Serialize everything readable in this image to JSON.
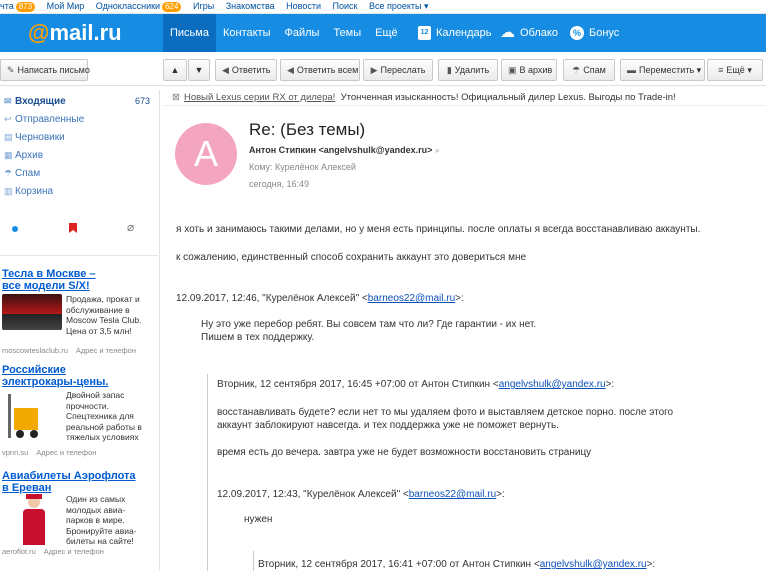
{
  "topbar": {
    "items": [
      {
        "label": "чта",
        "badge": "873"
      },
      {
        "label": "Мой Мир",
        "badge": ""
      },
      {
        "label": "Одноклассники",
        "badge": "624"
      },
      {
        "label": "Игры",
        "badge": ""
      },
      {
        "label": "Знакомства",
        "badge": ""
      },
      {
        "label": "Новости",
        "badge": ""
      },
      {
        "label": "Поиск",
        "badge": ""
      },
      {
        "label": "Все проекты",
        "badge": ""
      }
    ]
  },
  "header": {
    "logo_at": "@",
    "logo_text": "mail.ru",
    "nav": [
      "Письма",
      "Контакты",
      "Файлы",
      "Темы",
      "Ещё"
    ],
    "services": [
      {
        "label": "Календарь",
        "icon": "calendar-icon",
        "glyph": "12"
      },
      {
        "label": "Облако",
        "icon": "cloud-icon",
        "glyph": "☁"
      },
      {
        "label": "Бонус",
        "icon": "percent-icon",
        "glyph": "%"
      }
    ]
  },
  "toolbar": {
    "compose": "Написать письмо",
    "reply": "Ответить",
    "reply_all": "Ответить всем",
    "forward": "Переслать",
    "delete": "Удалить",
    "archive": "В архив",
    "spam": "Спам",
    "move": "Переместить",
    "more": "Ещё"
  },
  "sidebar": {
    "folders": [
      {
        "label": "Входящие",
        "count": "673",
        "icon": "inbox-icon",
        "glyph": "✉"
      },
      {
        "label": "Отправленные",
        "count": "",
        "icon": "sent-icon",
        "glyph": "↩"
      },
      {
        "label": "Черновики",
        "count": "",
        "icon": "drafts-icon",
        "glyph": "▤"
      },
      {
        "label": "Архив",
        "count": "",
        "icon": "archive-icon",
        "glyph": "▦"
      },
      {
        "label": "Спам",
        "count": "",
        "icon": "spam-icon",
        "glyph": "☂"
      },
      {
        "label": "Корзина",
        "count": "",
        "icon": "trash-icon",
        "glyph": "▥"
      }
    ],
    "ads": [
      {
        "title": "Тесла в Москве – все модели S/X!",
        "text": "Продажа, прокат и обслуживание в Moscow Tesla Club. Цена от 3,5 млн!",
        "domain": "moscowteslaclub.ru",
        "contacts": "Адрес и телефон"
      },
      {
        "title": "Российские электрокары-цены.",
        "text": "Двойной запас прочности. Спецтехника для реальной работы в тяжелых условиях",
        "domain": "vpnn.su",
        "contacts": "Адрес и телефон"
      },
      {
        "title": "Авиабилеты Аэрофлота в Ереван",
        "text": "Один из самых молодых авиа-парков в мире. Бронируйте авиа-билеты на сайте!",
        "domain": "aeroflot.ru",
        "contacts": "Адрес и телефон"
      }
    ]
  },
  "message": {
    "promo_link": "Новый Lexus серии RX от дилера!",
    "promo_text": "Утонченная изысканность! Официальный дилер Lexus. Выгоды по Trade-in!",
    "avatar_letter": "А",
    "subject": "Re: (Без темы)",
    "from_name": "Антон Стипкин",
    "from_email": "<angelvshulk@yandex.ru>",
    "to": "Кому: Курелёнок Алексей",
    "date": "сегодня, 16:49",
    "body_1": "я хоть и занимаюсь такими делами, но у меня есть принципы. после оплаты я всегда восстанавливаю аккаунты.",
    "body_2": "к сожалению, единственный способ сохранить аккаунт это довериться мне",
    "q1_header": "12.09.2017, 12:46, \"Курелёнок Алексей\" <",
    "q1_email": "barneos22@mail.ru",
    "q1_end": ">:",
    "q1_line1": "Ну это уже перебор ребят. Вы совсем там что ли? Где гарантии - их нет.",
    "q1_line2": "Пишем в тех поддержку.",
    "q2_header": "Вторник, 12 сентября 2017, 16:45 +07:00 от Антон Стипкин <",
    "q2_email": "angelvshulk@yandex.ru",
    "q2_end": ">:",
    "q2_line1": "восстанавливать будете? если нет то мы удаляем фото и выставляем детское порно. после этого",
    "q2_line2": "аккаунт заблокируют навсегда. и тех поддержка уже не поможет вернуть.",
    "q2_line3": "время есть до вечера. завтра уже не будет возможности восстановить страницу",
    "q3_header": "12.09.2017, 12:43, \"Курелёнок Алексей\" <",
    "q3_email": "barneos22@mail.ru",
    "q3_end": ">:",
    "q3_line1": "нужен",
    "q4_header": "Вторник, 12 сентября 2017, 16:41 +07:00 от Антон Стипкин <",
    "q4_email": "angelvshulk@yandex.ru",
    "q4_end": ">:"
  }
}
